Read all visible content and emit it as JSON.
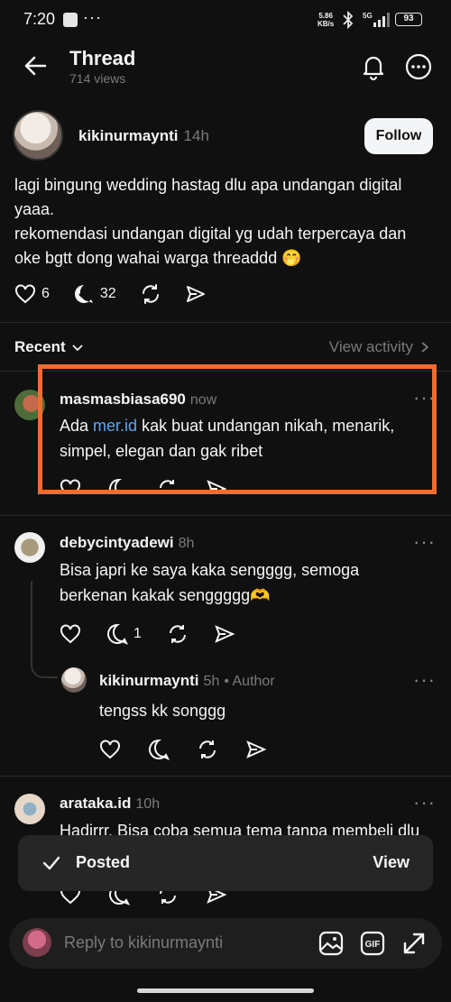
{
  "status_bar": {
    "time": "7:20",
    "dots": "···",
    "net_speed": "5.86",
    "net_unit": "KB/s",
    "signal": "5G",
    "battery": "93"
  },
  "header": {
    "title": "Thread",
    "views": "714 views"
  },
  "post": {
    "username": "kikinurmaynti",
    "time": "14h",
    "follow_label": "Follow",
    "text": "lagi bingung wedding hastag dlu apa undangan digital yaaa.\nrekomendasi undangan digital yg udah terpercaya dan oke bgtt dong wahai warga threaddd 🤭",
    "likes": "6",
    "replies": "32"
  },
  "sort": {
    "label": "Recent",
    "view_activity": "View activity"
  },
  "replies": [
    {
      "username": "masmasbiasa690",
      "time": "now",
      "text_before": "Ada ",
      "link": "mer.id",
      "text_after": " kak buat undangan nikah, menarik, simpel, elegan dan gak ribet"
    },
    {
      "username": "debycintyadewi",
      "time": "8h",
      "text": "Bisa japri ke saya kaka sengggg,  semoga berkenan kakak senggggg🫶",
      "reply_count": "1"
    },
    {
      "username": "kikinurmaynti",
      "time": "5h",
      "author": "• Author",
      "text": "tengss kk songgg"
    },
    {
      "username": "arataka.id",
      "time": "10h",
      "text": "Hadirrr. Bisa coba semua tema tanpa membeli dlu kak"
    }
  ],
  "toast": {
    "label": "Posted",
    "action": "View"
  },
  "reply_bar": {
    "placeholder": "Reply to kikinurmaynti"
  },
  "colors": {
    "accent_link": "#5aa7f5",
    "highlight": "#f26b2f",
    "background": "#101010"
  }
}
